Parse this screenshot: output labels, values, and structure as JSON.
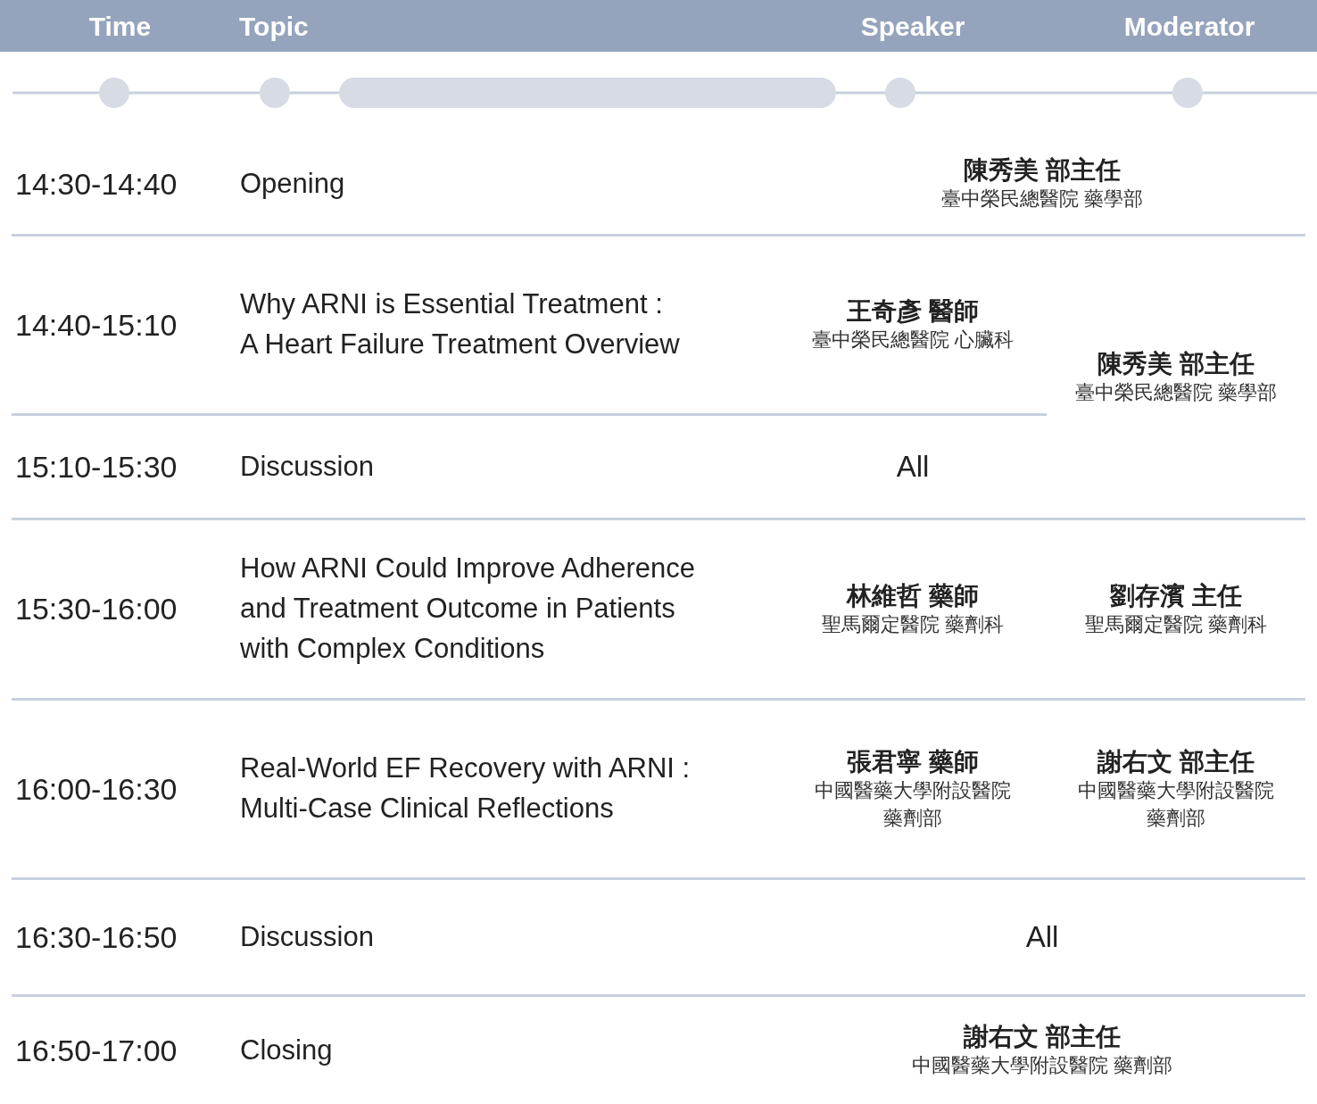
{
  "header": {
    "columns": [
      "Time",
      "Topic",
      "Speaker",
      "Moderator"
    ]
  },
  "sessions": [
    {
      "time": "14:30-14:40",
      "topic": [
        "Opening"
      ],
      "kind": "shared",
      "shared": {
        "kind": "person",
        "name": "陳秀美 部主任",
        "affiliation": [
          "臺中榮民總醫院 藥學部"
        ]
      }
    },
    {
      "time": "14:40-15:10",
      "topic": [
        "Why ARNI is Essential Treatment :",
        "A Heart Failure Treatment Overview"
      ],
      "kind": "split",
      "speaker": {
        "kind": "person",
        "name": "王奇彥 醫師",
        "affiliation": [
          "臺中榮民總醫院 心臟科"
        ]
      },
      "moderator": {
        "kind": "person",
        "name": "陳秀美 部主任",
        "affiliation": [
          "臺中榮民總醫院 藥學部"
        ]
      }
    },
    {
      "time": "15:10-15:30",
      "topic": [
        "Discussion"
      ],
      "kind": "split",
      "speaker": {
        "kind": "text",
        "text": "All"
      }
    },
    {
      "time": "15:30-16:00",
      "topic": [
        "How ARNI Could Improve Adherence",
        "and Treatment Outcome in Patients",
        "with Complex Conditions"
      ],
      "kind": "split",
      "speaker": {
        "kind": "person",
        "name": "林維哲 藥師",
        "affiliation": [
          "聖馬爾定醫院 藥劑科"
        ]
      },
      "moderator": {
        "kind": "person",
        "name": "劉存濱 主任",
        "affiliation": [
          "聖馬爾定醫院 藥劑科"
        ]
      }
    },
    {
      "time": "16:00-16:30",
      "topic": [
        "Real-World EF Recovery with ARNI :",
        "Multi-Case Clinical Reflections"
      ],
      "kind": "split",
      "speaker": {
        "kind": "person",
        "name": "張君寧 藥師",
        "affiliation": [
          "中國醫藥大學附設醫院",
          "藥劑部"
        ]
      },
      "moderator": {
        "kind": "person",
        "name": "謝右文 部主任",
        "affiliation": [
          "中國醫藥大學附設醫院",
          "藥劑部"
        ]
      }
    },
    {
      "time": "16:30-16:50",
      "topic": [
        "Discussion"
      ],
      "kind": "shared",
      "shared": {
        "kind": "text",
        "text": "All"
      }
    },
    {
      "time": "16:50-17:00",
      "topic": [
        "Closing"
      ],
      "kind": "shared",
      "shared": {
        "kind": "person",
        "name": "謝右文 部主任",
        "affiliation": [
          "中國醫藥大學附設醫院 藥劑部"
        ]
      }
    }
  ]
}
